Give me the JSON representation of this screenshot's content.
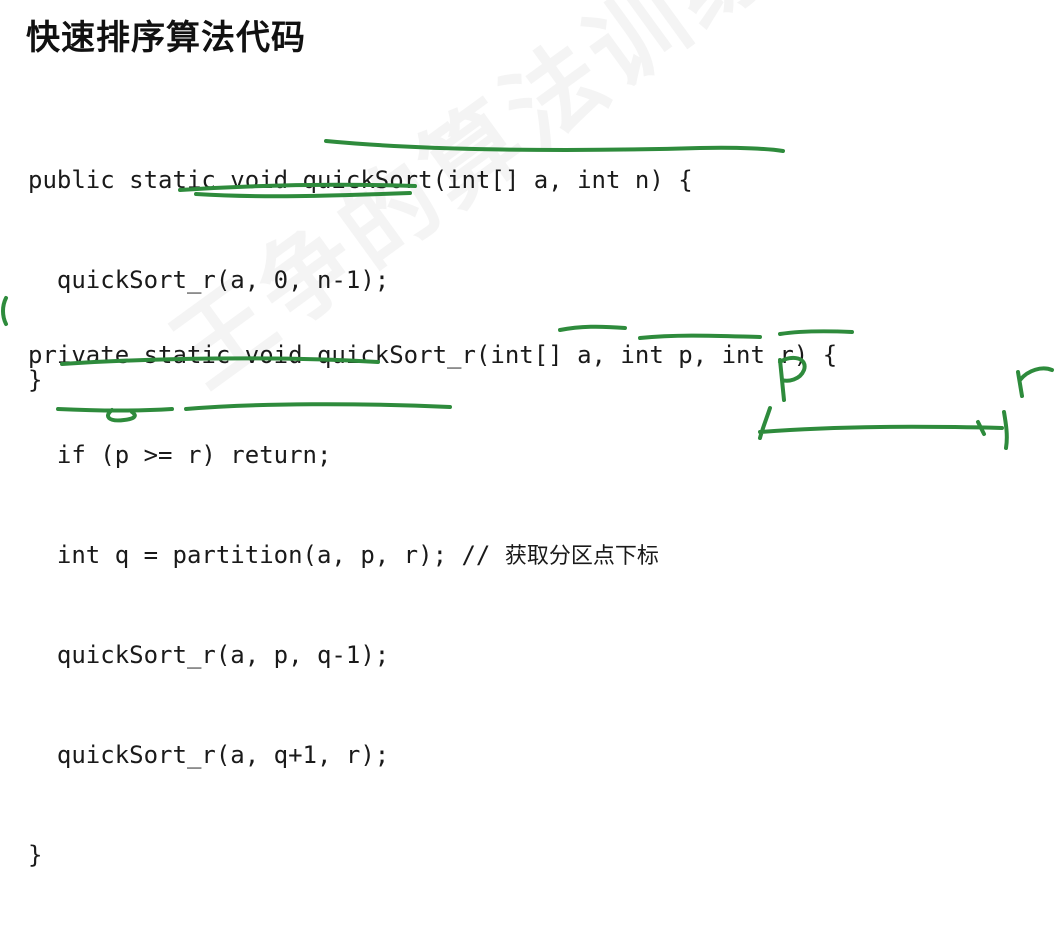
{
  "slide": {
    "title": "快速排序算法代码",
    "watermark": "王争的算法训练营",
    "code_block_1": {
      "lines": [
        "public static void quickSort(int[] a, int n) {",
        "  quickSort_r(a, 0, n-1);",
        "}"
      ]
    },
    "code_block_2": {
      "lines": [
        "private static void quickSort_r(int[] a, int p, int r) {",
        "  if (p >= r) return;",
        "  int q = partition(a, p, r); // ",
        "  quickSort_r(a, p, q-1);",
        "  quickSort_r(a, q+1, r);",
        "}"
      ],
      "comment_cn": "获取分区点下标"
    },
    "handwriting": {
      "label_p": "p",
      "label_r": "r"
    },
    "colors": {
      "background": "#ffffff",
      "text": "#1a1a1a",
      "annotation_ink": "#2e8b3c"
    }
  }
}
